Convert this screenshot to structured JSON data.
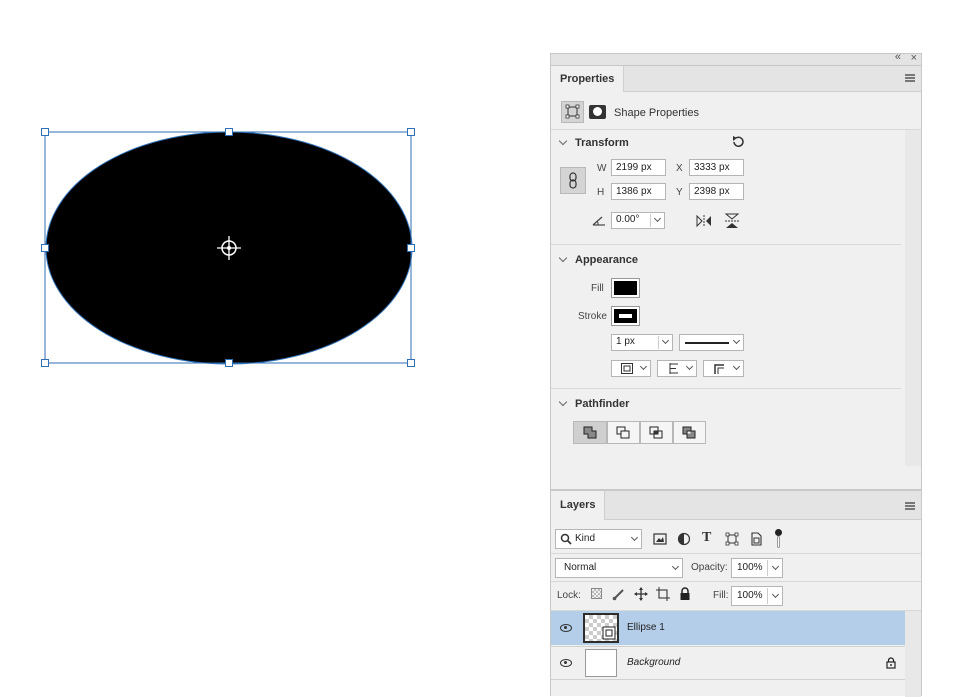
{
  "properties_panel": {
    "tab": "Properties",
    "shape_properties_label": "Shape Properties",
    "transform": {
      "title": "Transform",
      "w_label": "W",
      "w_value": "2199 px",
      "h_label": "H",
      "h_value": "1386 px",
      "x_label": "X",
      "x_value": "3333 px",
      "y_label": "Y",
      "y_value": "2398 px",
      "angle_value": "0.00°"
    },
    "appearance": {
      "title": "Appearance",
      "fill_label": "Fill",
      "stroke_label": "Stroke",
      "stroke_width": "1 px",
      "fill_color": "#000000"
    },
    "pathfinder": {
      "title": "Pathfinder"
    }
  },
  "layers_panel": {
    "tab": "Layers",
    "filter_kind": "Kind",
    "blend_mode": "Normal",
    "opacity_label": "Opacity:",
    "opacity_value": "100%",
    "lock_label": "Lock:",
    "fill_label": "Fill:",
    "fill_value": "100%",
    "layers": [
      {
        "name": "Ellipse 1",
        "selected": true
      },
      {
        "name": "Background",
        "selected": false,
        "locked": true
      }
    ]
  },
  "colors": {
    "selection_blue": "#2f6fb5",
    "selected_layer_bg": "#b4cde8"
  }
}
